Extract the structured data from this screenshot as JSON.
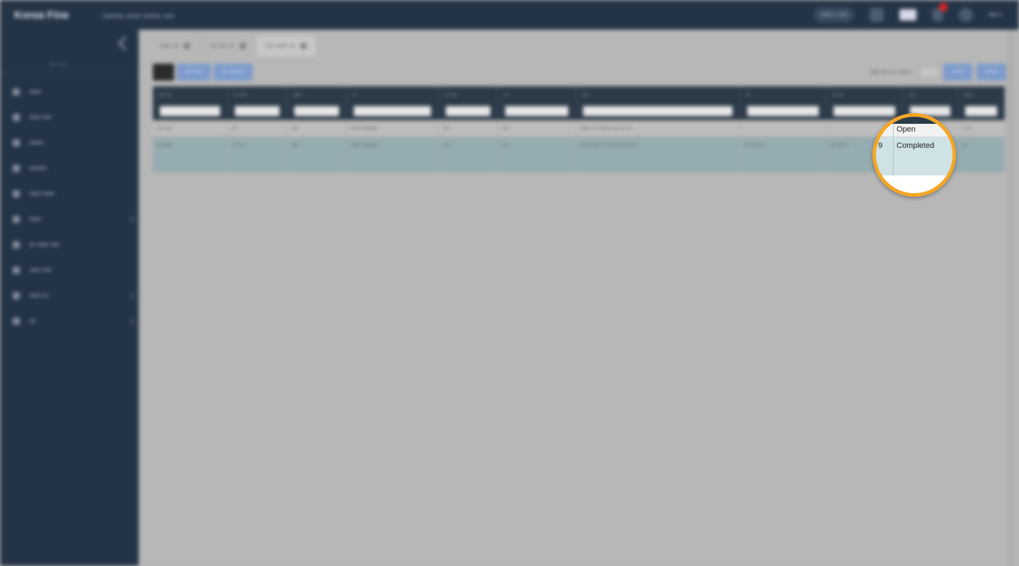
{
  "app": {
    "brand": "Korea Fine",
    "breadcrumb": "▪▪▪▪▪▪ ▪▪▪▪ ▪▪▪▪▪ ▪▪▪"
  },
  "header": {
    "language_pill": "▪▪▪▪ ▪ ▪▪▪",
    "user_label": "▪▪▪ ▪"
  },
  "sidebar": {
    "caption": "▪▪▪ ▪▪▪",
    "items": [
      {
        "label": "▪▪▪▪",
        "icon": "dashboard-icon",
        "has_children": false
      },
      {
        "label": "▪▪▪▪ ▪▪▪",
        "icon": "list-icon",
        "has_children": false
      },
      {
        "label": "▪▪▪▪▪",
        "icon": "document-icon",
        "has_children": false
      },
      {
        "label": "▪▪▪▪▪▪",
        "icon": "folder-icon",
        "has_children": false
      },
      {
        "label": "▪▪▪▪ ▪▪▪▪",
        "icon": "report-icon",
        "has_children": false
      },
      {
        "label": "▪▪▪▪",
        "icon": "settings-icon",
        "has_children": true
      },
      {
        "label": "▪▪ ▪▪▪▪ ▪▪▪",
        "icon": "file-icon",
        "has_children": false
      },
      {
        "label": "▪▪▪▪ ▪▪▪",
        "icon": "chart-icon",
        "has_children": false
      },
      {
        "label": "▪▪▪▪ ▪▪",
        "icon": "archive-icon",
        "has_children": true
      },
      {
        "label": "▪▪",
        "icon": "gear-icon",
        "has_children": true
      }
    ]
  },
  "tabs": [
    {
      "label": "▪▪▪▪ ▪▪"
    },
    {
      "label": "▪▪ ▪▪▪ ▪▪"
    },
    {
      "label": "▪▪▪ ▪▪▪▪ ▪▪"
    }
  ],
  "toolbar": {
    "btn1": "▪▪▪ ▪▪▪",
    "btn2": "▪▪ ▪▪▪▪▪▪",
    "right_label": "▪▪▪▪ ▪▪▪ ▪▪ ▪▪▪▪▪",
    "right_btn1": "▪▪▪▪▪",
    "right_btn2": "▪▪▪▪▪"
  },
  "grid": {
    "columns": [
      "▪▪▪ ▪▪",
      "▪▪ ▪▪▪",
      "▪▪▪▪",
      "▪▪",
      "▪▪ ▪▪▪",
      "▪▪",
      "▪▪▪",
      "▪▪",
      "▪▪ ▪▪",
      "▪▪▪",
      "▪▪▪▪"
    ],
    "rows": [
      [
        "▪▪ ▪▪▪▪",
        "▪▪",
        "▪▪▪",
        "▪▪▪▪ ▪▪▪▪▪▪▪",
        "▪▪▪",
        "▪▪▪",
        "▪▪▪▪ ▪ ▪▪ ▪▪▪▪ ▪▪▪ ▪▪ ▪▪",
        "",
        "",
        "",
        "▪ ▪▪"
      ],
      [
        "▪▪ ▪▪▪▪",
        "▪ ▪▪ ▪",
        "▪▪▪",
        "▪▪▪▪ ▪▪▪▪▪▪▪",
        "▪▪▪",
        "▪▪▪",
        "▪▪ ▪▪ ▪▪▪ ▪ ▪▪ ▪▪ ▪▪ ▪▪ ▪▪▪",
        "▪▪ ▪▪▪ ▪▪",
        "▪▪ ▪▪▪ ▪",
        "",
        "▪▪"
      ]
    ]
  },
  "magnifier": {
    "border_color": "#f5a623",
    "row1_status": "Open",
    "row2_prefix": "9",
    "row2_status": "Completed"
  }
}
